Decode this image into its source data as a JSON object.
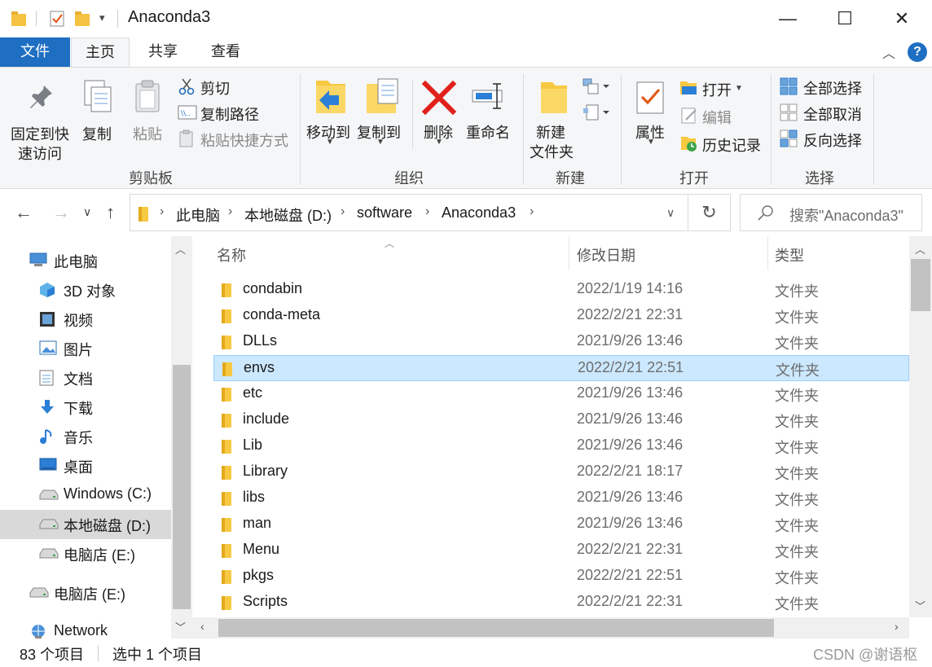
{
  "window": {
    "title": "Anaconda3",
    "controls": {
      "minimize": "—",
      "maximize": "☐",
      "close": "✕"
    }
  },
  "ribbon_tabs": {
    "file": "文件",
    "home": "主页",
    "share": "共享",
    "view": "查看"
  },
  "ribbon": {
    "clipboard": {
      "group_label": "剪贴板",
      "pin_line1": "固定到快",
      "pin_line2": "速访问",
      "copy": "复制",
      "paste": "粘贴",
      "cut": "剪切",
      "copy_path": "复制路径",
      "paste_shortcut": "粘贴快捷方式"
    },
    "organize": {
      "group_label": "组织",
      "move_to": "移动到",
      "copy_to": "复制到",
      "delete": "删除",
      "rename": "重命名"
    },
    "new": {
      "group_label": "新建",
      "new_folder_line1": "新建",
      "new_folder_line2": "文件夹"
    },
    "open": {
      "group_label": "打开",
      "properties": "属性",
      "open": "打开",
      "edit": "编辑",
      "history": "历史记录"
    },
    "select": {
      "group_label": "选择",
      "select_all": "全部选择",
      "select_none": "全部取消",
      "invert": "反向选择"
    }
  },
  "address": {
    "crumbs": [
      "此电脑",
      "本地磁盘 (D:)",
      "software",
      "Anaconda3"
    ],
    "search_placeholder": "搜索\"Anaconda3\""
  },
  "nav": {
    "items": [
      {
        "label": "此电脑",
        "icon": "pc-icon"
      },
      {
        "label": "3D 对象",
        "icon": "cube-icon"
      },
      {
        "label": "视频",
        "icon": "video-icon"
      },
      {
        "label": "图片",
        "icon": "picture-icon"
      },
      {
        "label": "文档",
        "icon": "document-icon"
      },
      {
        "label": "下载",
        "icon": "download-icon"
      },
      {
        "label": "音乐",
        "icon": "music-icon"
      },
      {
        "label": "桌面",
        "icon": "desktop-icon"
      },
      {
        "label": "Windows (C:)",
        "icon": "drive-icon"
      },
      {
        "label": "本地磁盘 (D:)",
        "icon": "drive-icon"
      },
      {
        "label": "电脑店 (E:)",
        "icon": "drive-icon"
      },
      {
        "label": "电脑店 (E:)",
        "icon": "drive-icon"
      },
      {
        "label": "Network",
        "icon": "network-icon"
      }
    ],
    "selected_index": 9
  },
  "filelist": {
    "columns": {
      "name": "名称",
      "date": "修改日期",
      "type": "类型"
    },
    "selected_index": 3,
    "rows": [
      {
        "name": "condabin",
        "date": "2022/1/19 14:16",
        "type": "文件夹"
      },
      {
        "name": "conda-meta",
        "date": "2022/2/21 22:31",
        "type": "文件夹"
      },
      {
        "name": "DLLs",
        "date": "2021/9/26 13:46",
        "type": "文件夹"
      },
      {
        "name": "envs",
        "date": "2022/2/21 22:51",
        "type": "文件夹"
      },
      {
        "name": "etc",
        "date": "2021/9/26 13:46",
        "type": "文件夹"
      },
      {
        "name": "include",
        "date": "2021/9/26 13:46",
        "type": "文件夹"
      },
      {
        "name": "Lib",
        "date": "2021/9/26 13:46",
        "type": "文件夹"
      },
      {
        "name": "Library",
        "date": "2022/2/21 18:17",
        "type": "文件夹"
      },
      {
        "name": "libs",
        "date": "2021/9/26 13:46",
        "type": "文件夹"
      },
      {
        "name": "man",
        "date": "2021/9/26 13:46",
        "type": "文件夹"
      },
      {
        "name": "Menu",
        "date": "2022/2/21 22:31",
        "type": "文件夹"
      },
      {
        "name": "pkgs",
        "date": "2022/2/21 22:51",
        "type": "文件夹"
      },
      {
        "name": "Scripts",
        "date": "2022/2/21 22:31",
        "type": "文件夹"
      }
    ]
  },
  "status": {
    "count": "83 个项目",
    "selected": "选中 1 个项目",
    "watermark": "CSDN @谢语枢"
  },
  "colors": {
    "file_tab": "#1e6fc2",
    "selection": "#cce8ff",
    "folder": "#f7c842"
  }
}
